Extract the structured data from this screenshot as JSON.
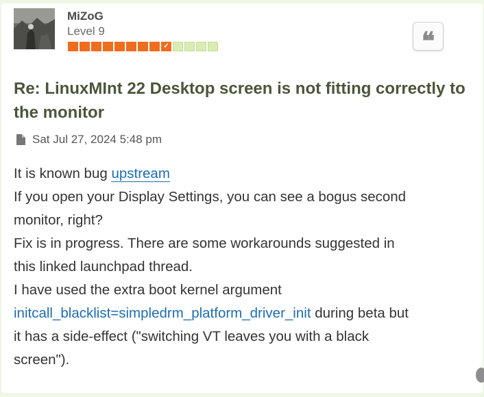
{
  "author": {
    "username": "MiZoG",
    "rank": "Level 9",
    "rank_bar": {
      "filled": 9,
      "total": 13,
      "mark": "✓"
    }
  },
  "actions": {
    "quote_icon": "quote-icon",
    "quote_glyph": "❝"
  },
  "post": {
    "title": "Re: LinuxMInt 22 Desktop screen is not fitting correctly to the monitor",
    "date": "Sat Jul 27, 2024 5:48 pm",
    "date_icon": "file-icon",
    "body": {
      "line1_prefix": "It is known bug ",
      "line1_link": "upstream",
      "line2": "If you open your Display Settings, you can see a bogus second",
      "line3": "monitor, right?",
      "line4": "Fix is in progress. There are some workarounds suggested in",
      "line5": "this linked launchpad thread.",
      "line6": "I have used the extra boot kernel argument",
      "line7_link": "initcall_blacklist=simpledrm_platform_driver_init",
      "line7_suffix": " during beta but",
      "line8": "it has a side-effect (\"switching VT leaves you with a black",
      "line9": "screen\")."
    }
  },
  "colors": {
    "page_background": "#eef7e3",
    "title": "#4b553a",
    "link": "#1e6cb0",
    "rank_on": "#ef6d1f",
    "rank_off": "#d8ecb4"
  }
}
